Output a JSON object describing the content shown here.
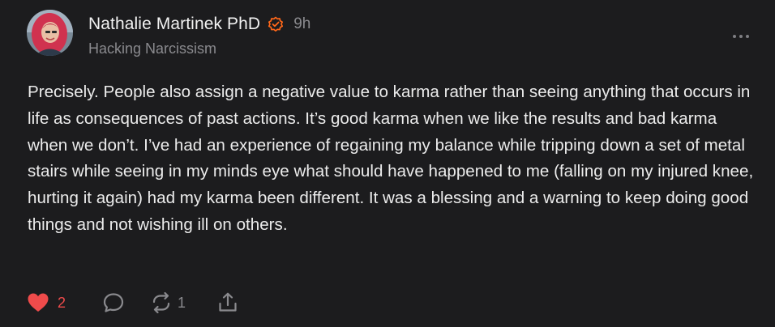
{
  "post": {
    "author_name": "Nathalie Martinek PhD",
    "timestamp": "9h",
    "publication": "Hacking Narcissism",
    "body": "Precisely. People also assign a negative value to karma rather than seeing anything that occurs in life as consequences of past actions. It’s good karma when we like the results and bad karma when we don’t. I’ve had an experience of regaining my balance while tripping down a set of metal stairs while seeing in my minds eye what should have happened to me (falling on my injured knee, hurting it again) had my karma been different. It was a blessing and a warning to keep doing good things and not wishing ill on others."
  },
  "actions": {
    "like_count": "2",
    "restack_count": "1"
  },
  "icons": {
    "verified": "verified-badge-icon",
    "more": "more-horizontal-icon",
    "like": "heart-icon",
    "comment": "comment-bubble-icon",
    "restack": "restack-arrows-icon",
    "share": "share-upload-icon"
  },
  "colors": {
    "background": "#1c1c1e",
    "accent": "#ff6719",
    "like": "#ef4b4b",
    "muted": "#8a8a8e",
    "text": "#ececec"
  }
}
